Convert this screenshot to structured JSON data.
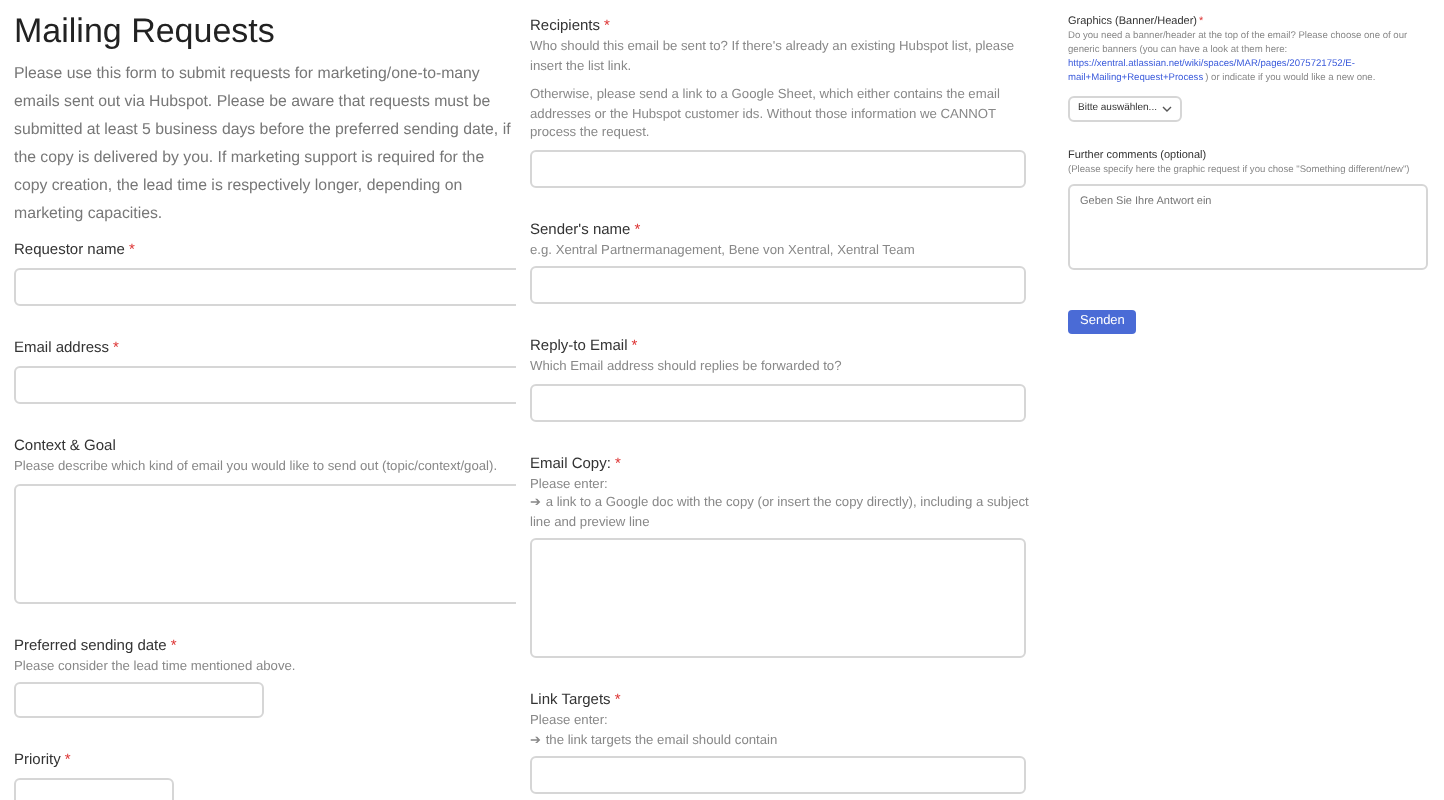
{
  "header": {
    "title": "Mailing Requests",
    "description": "Please use this form to submit requests for marketing/one-to-many emails sent out via Hubspot. Please be aware that requests must be submitted at least 5 business days before the preferred sending date, if the copy is delivered by you. If marketing support is required for the copy creation, the lead time is respectively longer, depending on marketing capacities."
  },
  "columns": [
    [
      {
        "kind": "text",
        "label": "Requestor name",
        "mark": "*"
      },
      {
        "kind": "text",
        "label": "Email address",
        "mark": "*"
      },
      {
        "kind": "textarea",
        "label": "Context & Goal",
        "hint": [
          [
            "Please describe which kind of email you would like to send out (topic/context/goal)."
          ]
        ]
      },
      {
        "kind": "date",
        "label": "Preferred sending date",
        "mark": "*",
        "hint": [
          [
            "Please consider the lead time mentioned above."
          ]
        ]
      },
      {
        "kind": "short",
        "label": "Priority",
        "mark": "*"
      }
    ],
    [
      {
        "kind": "text",
        "label": "Recipients",
        "mark": "*",
        "hint": [
          [
            "Who should this email be sent to? If there's already an existing Hubspot list, please insert the list link."
          ],
          [
            "Otherwise, please send a link to a Google Sheet, which either contains the email addresses or the Hubspot customer ids. Without those information we CANNOT process the request."
          ]
        ]
      },
      {
        "kind": "text",
        "label": "Sender's name",
        "mark": "*",
        "hint": [
          [
            "e.g. Xentral Partnermanagement, Bene von Xentral, Xentral Team"
          ]
        ]
      },
      {
        "kind": "text",
        "label": "Reply-to Email",
        "mark": "*",
        "hint": [
          [
            "Which Email address should replies be forwarded to?"
          ]
        ]
      },
      {
        "kind": "textarea",
        "label": "Email Copy:",
        "mark": "*",
        "hint": [
          [
            "Please enter:",
            "➔ a link to a Google doc with the copy (or insert the copy directly), including a subject line and preview line"
          ]
        ]
      },
      {
        "kind": "text",
        "label": "Link Targets",
        "mark": "*",
        "hint": [
          [
            "Please enter:",
            "➔ the link targets the email should contain"
          ]
        ]
      }
    ],
    [
      {
        "kind": "select",
        "label": "Graphics (Banner/Header)",
        "mark": "*",
        "hint_before": "Do you need a banner/header at the top of the email? Please choose one of our generic banners (you can have a look at them here:",
        "hint_link": [
          "https://xentral.atlassian.net/wiki/spaces/MAR/pages/2075721752/E-",
          "mail+Mailing+Request+Process"
        ],
        "hint_after": ") or indicate if you would like a new one.",
        "value": "Bitte auswählen..."
      },
      {
        "kind": "textarea",
        "label": "Further comments (optional)",
        "hint": [
          [
            "(Please specify here the graphic request if you chose \"Something different/new\")"
          ]
        ],
        "placeholder": "Geben Sie Ihre Antwort ein"
      }
    ]
  ],
  "submit_button": "Senden"
}
